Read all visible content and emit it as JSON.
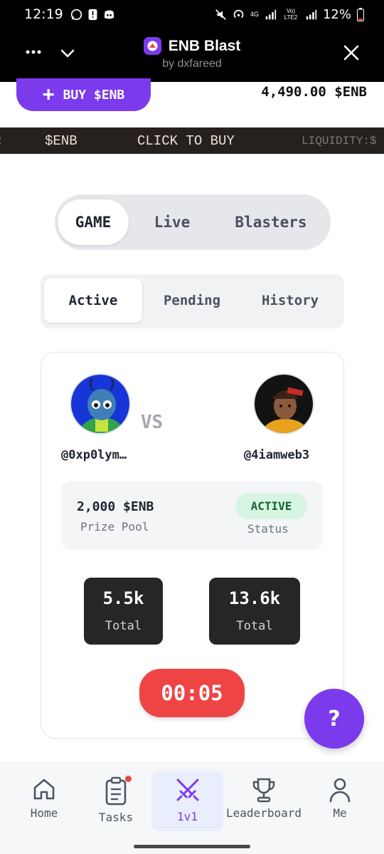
{
  "status_bar": {
    "time": "12:19",
    "battery": "12%",
    "network_label_1": "4G",
    "network_label_2": "Vo) LTE2"
  },
  "header": {
    "title": "ENB Blast",
    "subtitle": "by dxfareed"
  },
  "top": {
    "buy_label": "BUY $ENB",
    "balance": "4,490.00 $ENB"
  },
  "ticker": {
    "items": [
      "$ENB",
      "CLICK TO BUY",
      "LIQUIDITY:$"
    ]
  },
  "main_tabs": [
    {
      "label": "GAME",
      "active": true
    },
    {
      "label": "Live",
      "active": false
    },
    {
      "label": "Blasters",
      "active": false
    }
  ],
  "sub_tabs": [
    {
      "label": "Active",
      "active": true
    },
    {
      "label": "Pending",
      "active": false
    },
    {
      "label": "History",
      "active": false
    }
  ],
  "match": {
    "player1": "@0xp0lym…",
    "player2": "@4iamweb3",
    "vs": "VS",
    "prize_amount": "2,000 $ENB",
    "prize_label": "Prize Pool",
    "status_badge": "ACTIVE",
    "status_label": "Status",
    "total1_value": "5.5k",
    "total1_label": "Total",
    "total2_value": "13.6k",
    "total2_label": "Total",
    "timer": "00:05"
  },
  "help": {
    "label": "?"
  },
  "nav": [
    {
      "label": "Home",
      "icon": "home-icon"
    },
    {
      "label": "Tasks",
      "icon": "clipboard-icon"
    },
    {
      "label": "1v1",
      "icon": "crossed-swords-icon"
    },
    {
      "label": "Leaderboard",
      "icon": "trophy-icon"
    },
    {
      "label": "Me",
      "icon": "user-icon"
    }
  ],
  "colors": {
    "accent": "#7c3aed",
    "timer": "#ef4444",
    "status_badge_bg": "#d7f5e2",
    "ticker_bg": "#26211f"
  }
}
